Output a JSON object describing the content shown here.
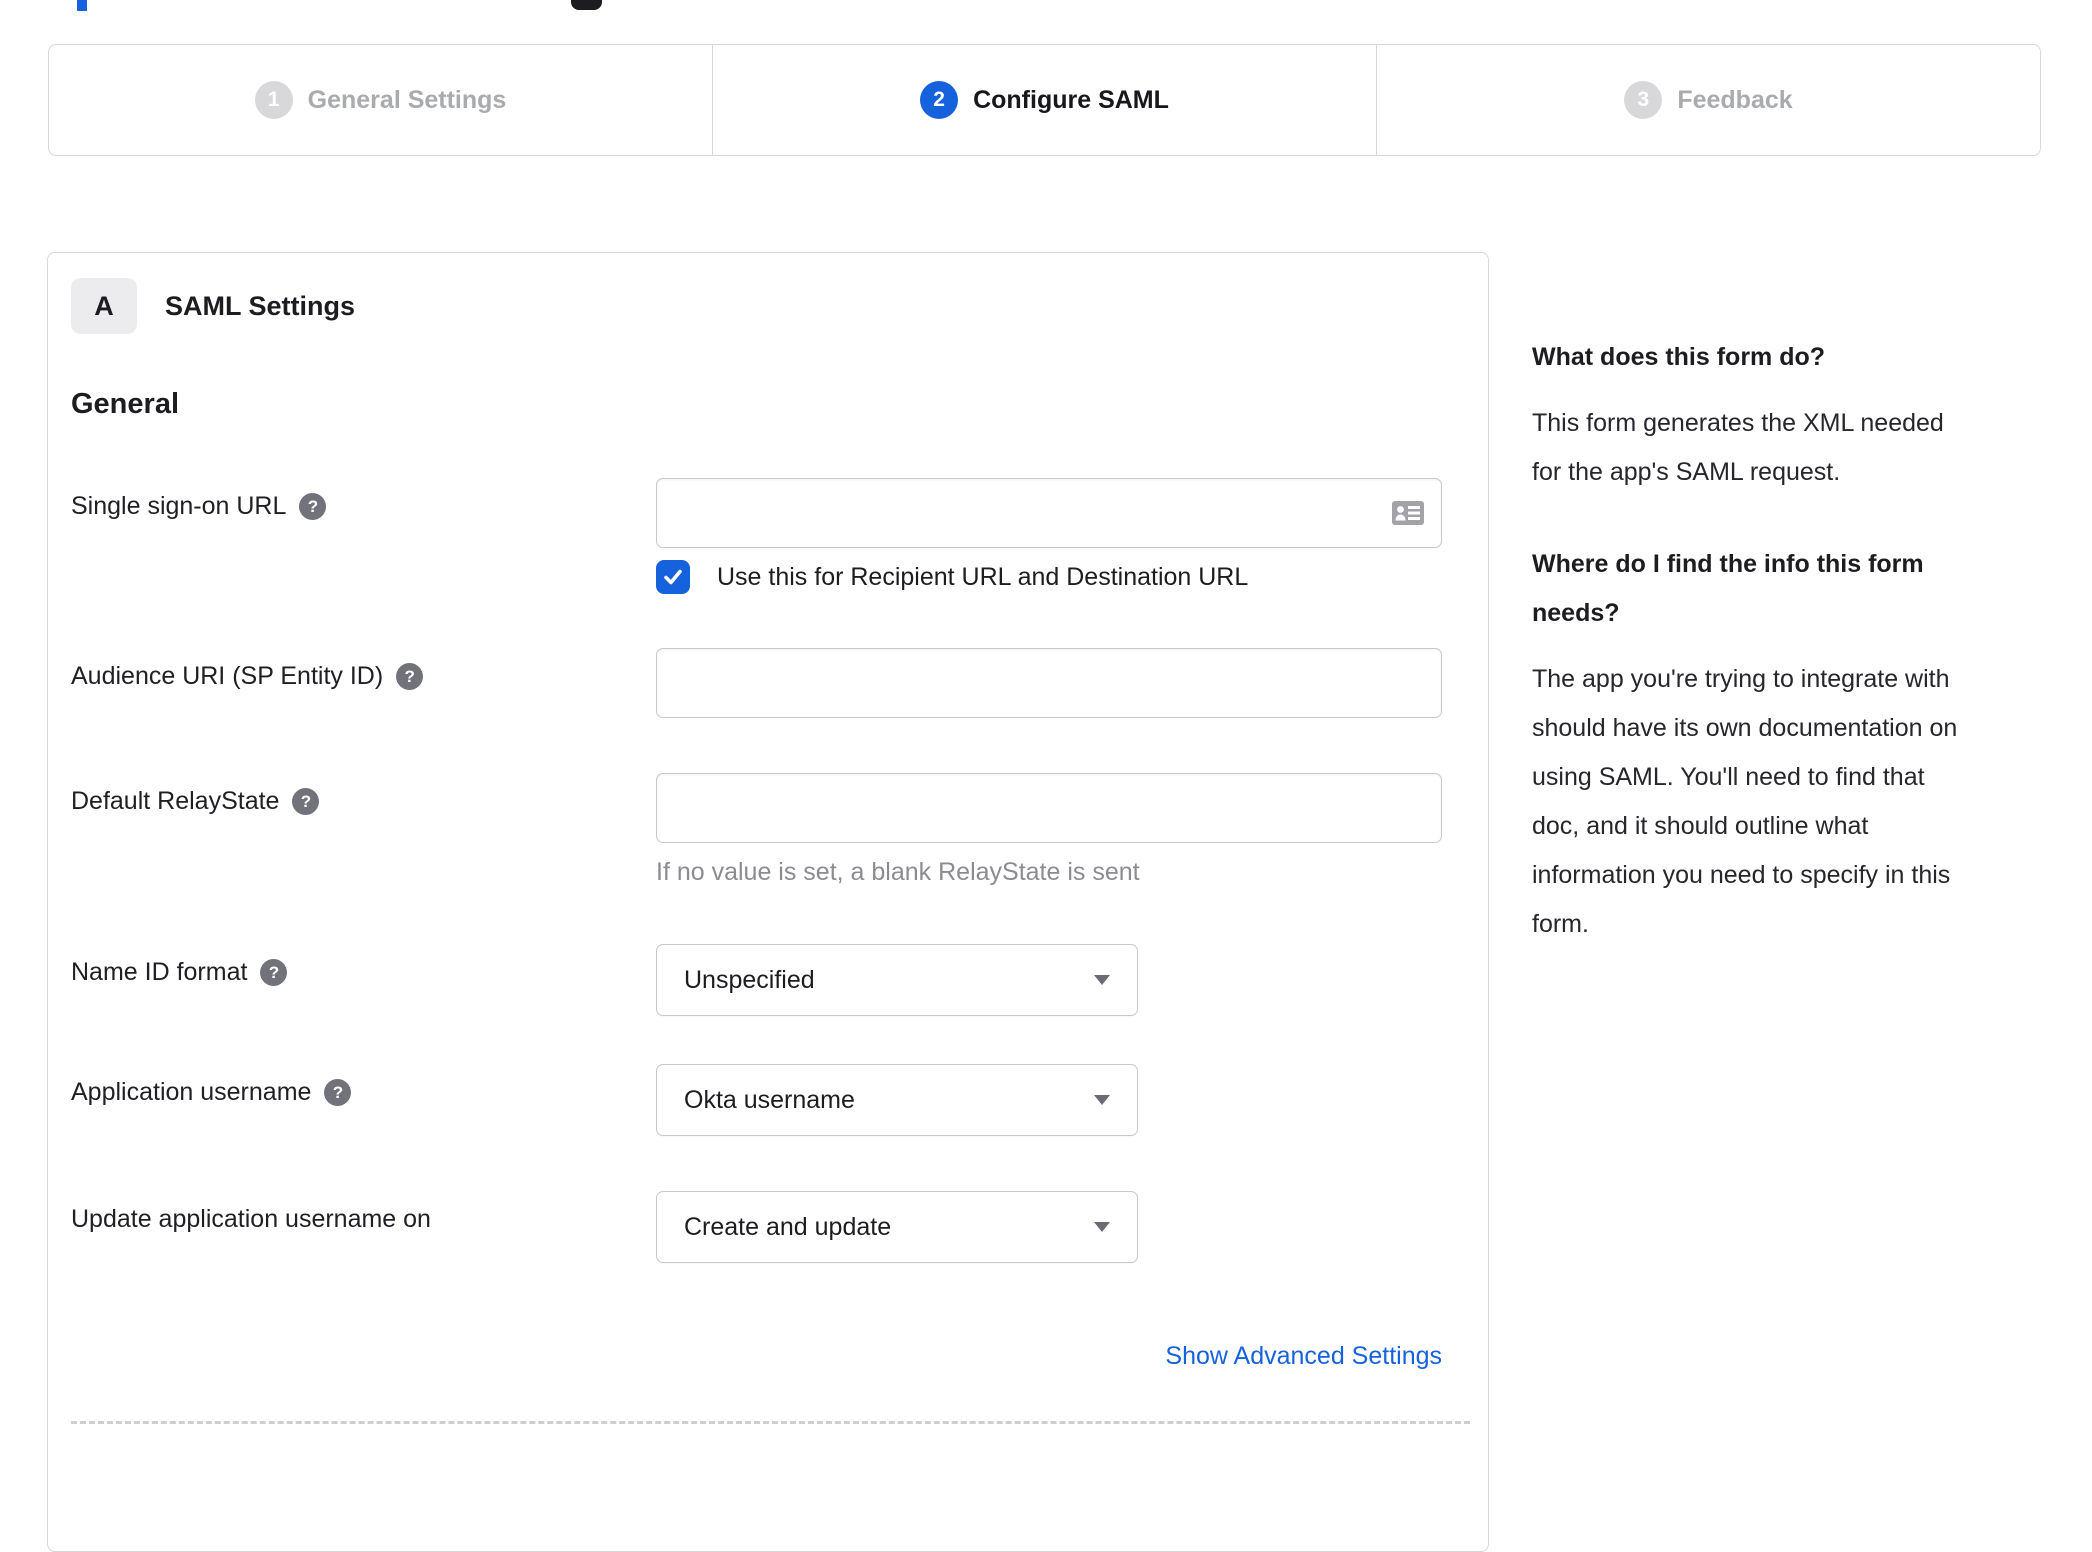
{
  "colors": {
    "accent_blue": "#1662dd",
    "inactive_gray": "#d8d8db",
    "border_gray": "#d8d8dc",
    "helper_text_gray": "#8b8b92"
  },
  "icons": {
    "help_glyph": "?",
    "help": "question-mark-circle",
    "input_right_icon": "contact-card",
    "select_arrow": "triangle-down",
    "checkbox_mark": "checkmark"
  },
  "stepper": {
    "steps": [
      {
        "number": "1",
        "label": "General Settings",
        "state": "inactive"
      },
      {
        "number": "2",
        "label": "Configure SAML",
        "state": "active"
      },
      {
        "number": "3",
        "label": "Feedback",
        "state": "inactive"
      }
    ]
  },
  "panel": {
    "badge_label": "A",
    "title": "SAML Settings",
    "section_heading": "General",
    "fields": [
      {
        "label": "Single sign-on URL",
        "has_help": true,
        "control": "text-input",
        "value": "",
        "checkbox_checked": true,
        "checkbox_label": "Use this for Recipient URL and Destination URL"
      },
      {
        "label": "Audience URI (SP Entity ID)",
        "has_help": true,
        "control": "text-input",
        "value": ""
      },
      {
        "label": "Default RelayState",
        "has_help": true,
        "control": "text-input",
        "value": "",
        "helper": "If no value is set, a blank RelayState is sent"
      },
      {
        "label": "Name ID format",
        "has_help": true,
        "control": "select",
        "value": "Unspecified"
      },
      {
        "label": "Application username",
        "has_help": true,
        "control": "select",
        "value": "Okta username"
      },
      {
        "label": "Update application username on",
        "has_help": false,
        "control": "select",
        "value": "Create and update"
      }
    ],
    "advanced_link": "Show Advanced Settings"
  },
  "sidebar": {
    "sections": [
      {
        "heading": "What does this form do?",
        "body": "This form generates the XML needed\nfor the app's SAML request."
      },
      {
        "heading": "Where do I find the info this form\nneeds?",
        "body": "The app you're trying to integrate with\nshould have its own documentation on\nusing SAML. You'll need to find that\ndoc, and it should outline what\ninformation you need to specify in this\nform."
      }
    ]
  }
}
